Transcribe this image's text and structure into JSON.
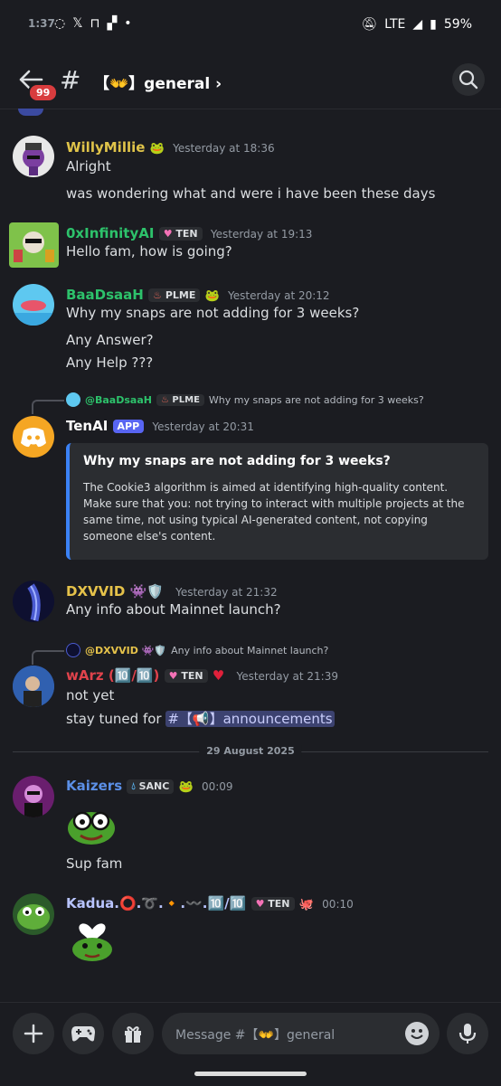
{
  "status": {
    "time": "1:37",
    "network": "LTE",
    "battery": "59%"
  },
  "header": {
    "badge": "99",
    "channel": "【👐】general"
  },
  "messages": [
    {
      "name": "WillyMillie",
      "time": "Yesterday at 18:36",
      "lines": [
        "Alright",
        "was wondering what and were i have been these days"
      ]
    },
    {
      "name": "0xInfinityAI",
      "tag": "TEN",
      "time": "Yesterday at 19:13",
      "lines": [
        "Hello fam, how is going?"
      ]
    },
    {
      "name": "BaaDsaaH",
      "tag": "PLME",
      "time": "Yesterday at 20:12",
      "lines": [
        "Why my snaps are not adding for 3 weeks?",
        "Any Answer?",
        "Any Help ???"
      ]
    },
    {
      "reply_user": "@BaaDsaaH",
      "reply_tag": "PLME",
      "reply_text": "Why my snaps are not adding for 3 weeks?",
      "name": "TenAI",
      "app_tag": "APP",
      "time": "Yesterday at 20:31",
      "embed_title": "Why my snaps are not adding for 3 weeks?",
      "embed_body": "The Cookie3 algorithm is aimed at identifying high-quality content. Make sure that you: not trying to interact with multiple projects at the same time, not using typical AI-generated content, not copying someone else's content."
    },
    {
      "name": "DXVVID 👾🛡️",
      "time": "Yesterday at 21:32",
      "lines": [
        "Any info about Mainnet launch?"
      ]
    },
    {
      "reply_user": "@DXVVID 👾🛡️",
      "reply_text": "Any info about Mainnet launch?",
      "name": "wArz (🔟/🔟)",
      "tag": "TEN",
      "time": "Yesterday at 21:39",
      "lines": [
        "not yet",
        "stay tuned for"
      ],
      "mention": "#【📢】announcements"
    },
    {
      "date": "29 August 2025"
    },
    {
      "name": "Kaizers",
      "tag": "SANC",
      "time": "00:09",
      "lines": [
        "Sup fam"
      ]
    },
    {
      "name": "Kadua.⭕.➰.🔸.〰️.🔟/🔟",
      "tag": "TEN",
      "time": "00:10"
    }
  ],
  "composer": {
    "placeholder": "Message #【👐】general"
  },
  "colors": {
    "bg": "#1b1c21",
    "willy": "#e0c44a",
    "infinity": "#2dc26b",
    "baad": "#2dc26b",
    "dxvvid": "#e5c24a",
    "warz": "#e0434c",
    "kaizers": "#5b8fe6",
    "kadua": "#b8c4ff",
    "accent": "#5865f2"
  }
}
